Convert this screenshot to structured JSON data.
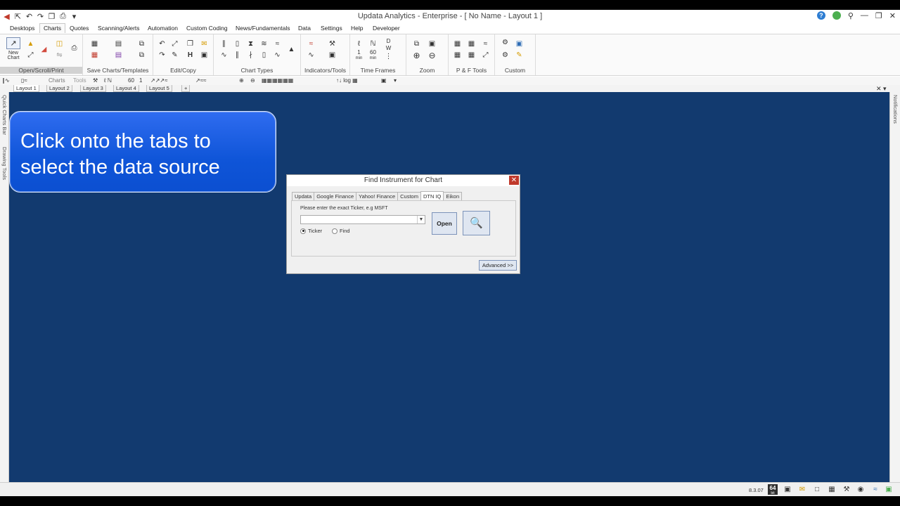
{
  "window": {
    "title": "Updata Analytics - Enterprise - [ No Name - Layout 1 ]"
  },
  "menu": {
    "tabs": [
      "Desktops",
      "Charts",
      "Quotes",
      "Scanning/Alerts",
      "Automation",
      "Custom Coding",
      "News/Fundamentals",
      "Data",
      "Settings",
      "Help",
      "Developer"
    ],
    "active": "Charts"
  },
  "ribbon": {
    "new_chart_label_1": "New",
    "new_chart_label_2": "Chart",
    "groups": [
      "Open/Scroll/Print",
      "Save Charts/Templates",
      "Edit/Copy",
      "Chart Types",
      "Indicators/Tools",
      "Time Frames",
      "Zoom",
      "P & F Tools",
      "Custom"
    ],
    "time_1": "1",
    "time_60": "60",
    "time_min_1": "min",
    "time_min_2": "min",
    "time_d": "D",
    "time_w": "W"
  },
  "toolbar": {
    "charts_label": "Charts",
    "tools_label": "Tools",
    "t_60": "60",
    "t_1": "1",
    "t_min": "min"
  },
  "layouts": {
    "tabs": [
      "Layout 1",
      "Layout 2",
      "Layout 3",
      "Layout 4",
      "Layout 5"
    ],
    "add": "+",
    "active": "Layout 1"
  },
  "sidebars": {
    "left_1": "Quick Charts Bar",
    "left_2": "Drawing Tools",
    "right_1": "Notifications"
  },
  "callout": {
    "line1": "Click onto the tabs to",
    "line2": "select the data source"
  },
  "dialog": {
    "title": "Find Instrument for Chart",
    "tabs": [
      "Updata",
      "Google Finance",
      "Yahoo! Finance",
      "Custom",
      "DTN IQ",
      "Eikon"
    ],
    "active_tab": "DTN IQ",
    "prompt": "Please enter the exact Ticker, e.g MSFT",
    "ticker_value": "",
    "radio_ticker": "Ticker",
    "radio_find": "Find",
    "open_button": "Open",
    "advanced_button": "Advanced >>"
  },
  "status": {
    "version": "8.3.07",
    "badge": "64",
    "badge_sub": "bit"
  }
}
